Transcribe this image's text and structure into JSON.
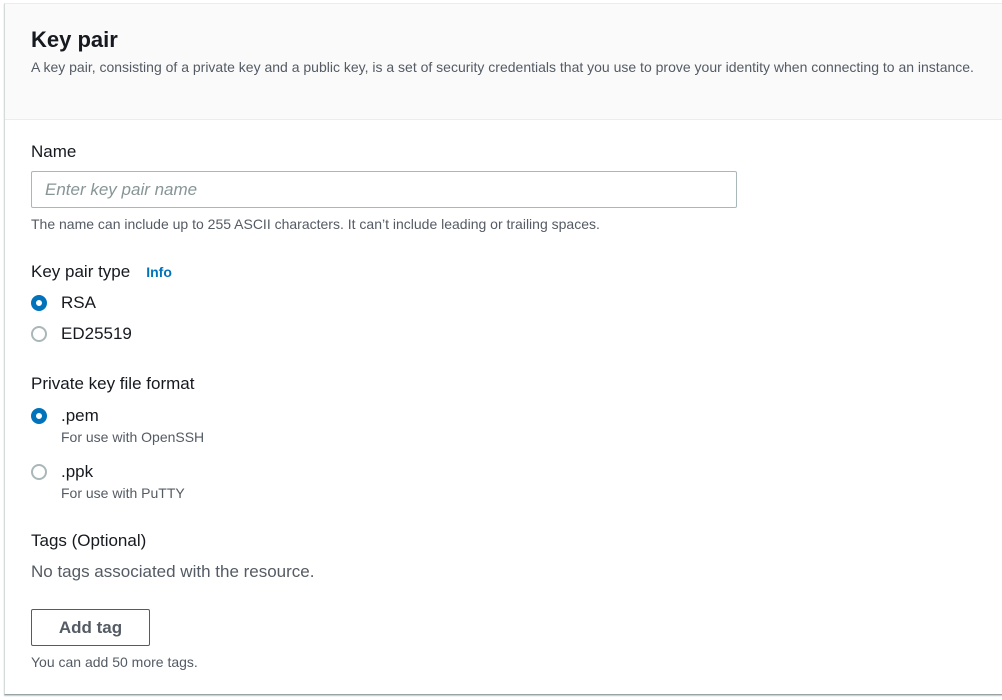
{
  "panel": {
    "title": "Key pair",
    "description": "A key pair, consisting of a private key and a public key, is a set of security credentials that you use to prove your identity when connecting to an instance."
  },
  "name_field": {
    "label": "Name",
    "value": "",
    "placeholder": "Enter key pair name",
    "hint": "The name can include up to 255 ASCII characters. It can’t include leading or trailing spaces."
  },
  "key_pair_type": {
    "label": "Key pair type",
    "info_link": "Info",
    "options": [
      {
        "label": "RSA",
        "selected": true
      },
      {
        "label": "ED25519",
        "selected": false
      }
    ]
  },
  "private_key_format": {
    "label": "Private key file format",
    "options": [
      {
        "label": ".pem",
        "description": "For use with OpenSSH",
        "selected": true
      },
      {
        "label": ".ppk",
        "description": "For use with PuTTY",
        "selected": false
      }
    ]
  },
  "tags": {
    "label": "Tags (Optional)",
    "empty_text": "No tags associated with the resource.",
    "add_button": "Add tag",
    "hint": "You can add 50 more tags."
  },
  "colors": {
    "accent": "#0073bb",
    "text": "#16191f",
    "secondary_text": "#545b64",
    "border": "#aab7b8"
  }
}
